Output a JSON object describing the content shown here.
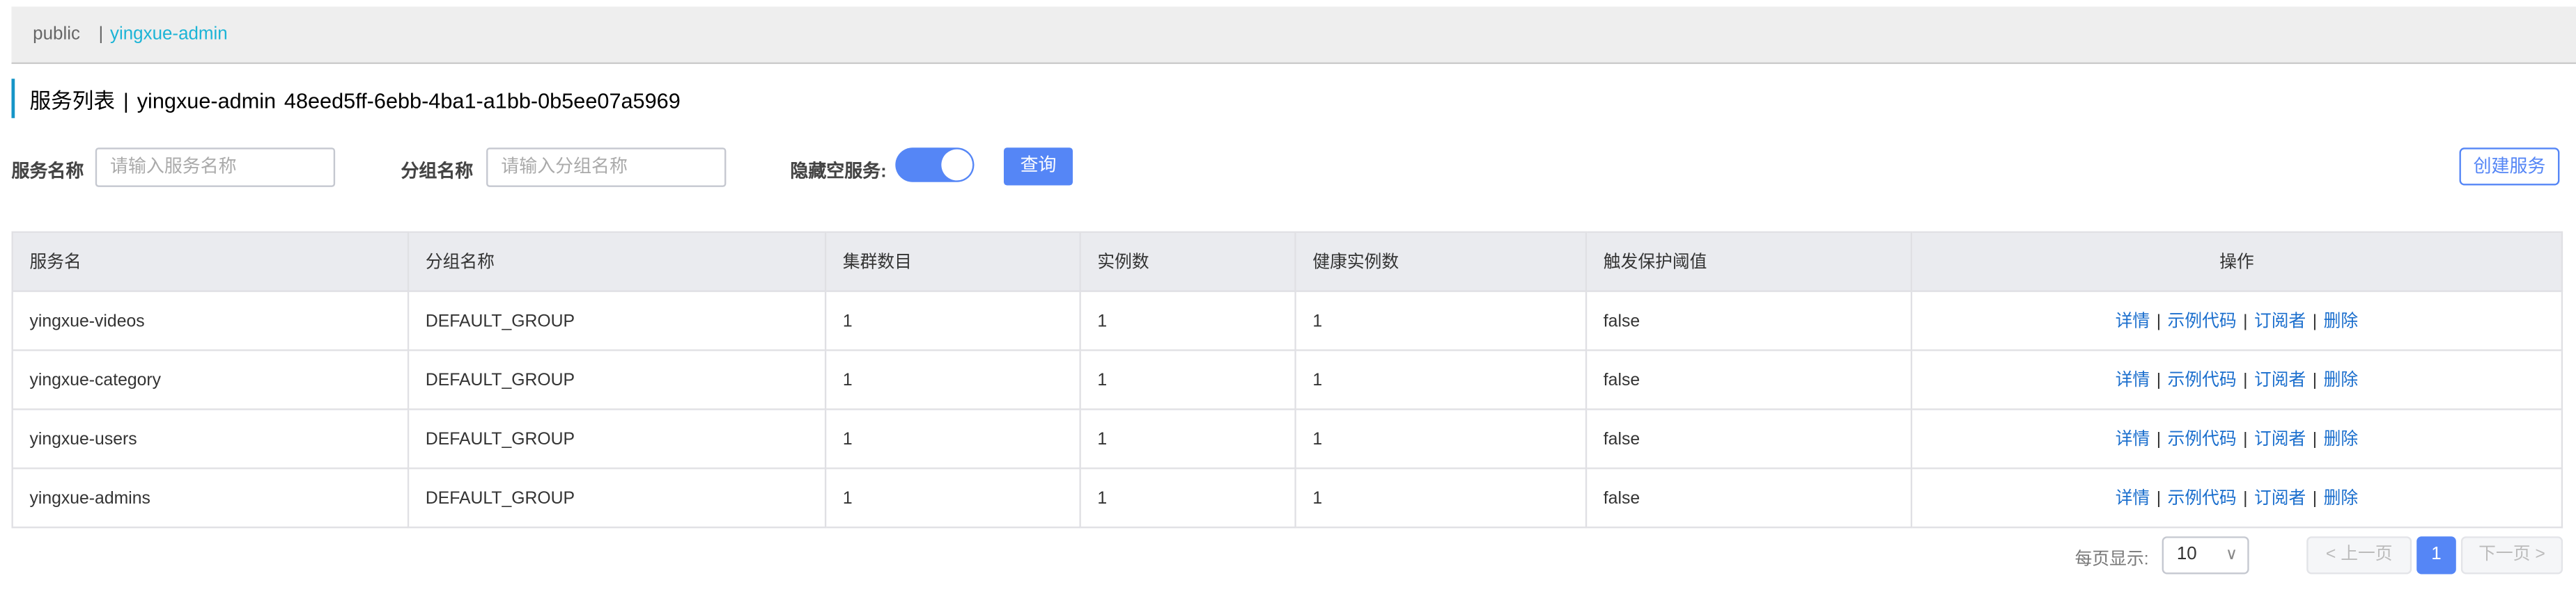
{
  "namespaces": {
    "items": [
      "public",
      "yingxue-admin"
    ],
    "active": "yingxue-admin",
    "separator": "|"
  },
  "title": {
    "label": "服务列表",
    "separator": "|",
    "namespace": "yingxue-admin",
    "namespace_id": "48eed5ff-6ebb-4ba1-a1bb-0b5ee07a5969",
    "accent_color": "#1595c7"
  },
  "filters": {
    "service_name_label": "服务名称",
    "service_name_placeholder": "请输入服务名称",
    "service_name_value": "",
    "group_name_label": "分组名称",
    "group_name_placeholder": "请输入分组名称",
    "group_name_value": "",
    "hide_empty_label": "隐藏空服务:",
    "hide_empty_on": true,
    "query_label": "查询",
    "create_label": "创建服务"
  },
  "table": {
    "columns": [
      "服务名",
      "分组名称",
      "集群数目",
      "实例数",
      "健康实例数",
      "触发保护阈值",
      "操作"
    ],
    "actions": [
      "详情",
      "示例代码",
      "订阅者",
      "删除"
    ],
    "action_separator": "|",
    "rows": [
      {
        "name": "yingxue-videos",
        "group": "DEFAULT_GROUP",
        "clusters": "1",
        "instances": "1",
        "healthy": "1",
        "protect": "false"
      },
      {
        "name": "yingxue-category",
        "group": "DEFAULT_GROUP",
        "clusters": "1",
        "instances": "1",
        "healthy": "1",
        "protect": "false"
      },
      {
        "name": "yingxue-users",
        "group": "DEFAULT_GROUP",
        "clusters": "1",
        "instances": "1",
        "healthy": "1",
        "protect": "false"
      },
      {
        "name": "yingxue-admins",
        "group": "DEFAULT_GROUP",
        "clusters": "1",
        "instances": "1",
        "healthy": "1",
        "protect": "false"
      }
    ]
  },
  "pagination": {
    "page_size_label": "每页显示:",
    "page_size": "10",
    "prev_label": "上一页",
    "next_label": "下一页",
    "current_page": "1",
    "accent_color": "#5586f6"
  }
}
